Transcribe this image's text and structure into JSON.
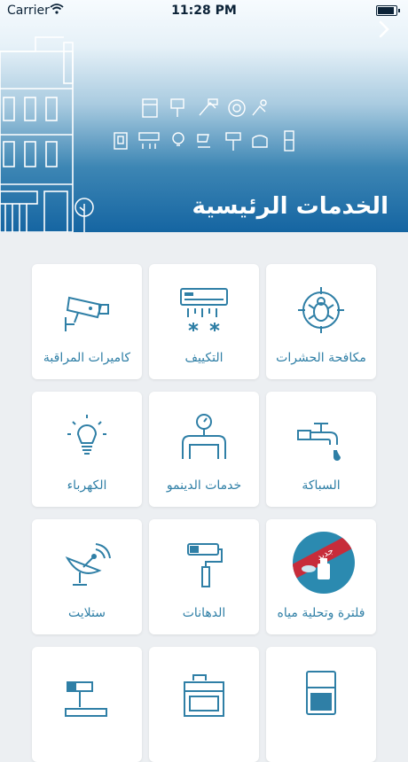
{
  "status_bar": {
    "carrier": "Carrier",
    "time": "11:28 PM"
  },
  "header": {
    "title": "الخدمات الرئيسية"
  },
  "services": [
    {
      "label": "مكافحة الحشرات",
      "icon": "bug-target-icon"
    },
    {
      "label": "التكييف",
      "icon": "air-conditioner-icon"
    },
    {
      "label": "كاميرات المراقبة",
      "icon": "security-camera-icon"
    },
    {
      "label": "السباكة",
      "icon": "water-tap-icon"
    },
    {
      "label": "خدمات الدينمو",
      "icon": "pipe-gauge-icon"
    },
    {
      "label": "الكهرباء",
      "icon": "light-bulb-icon"
    },
    {
      "label": "فلترة وتحلية مياه",
      "icon": "water-filter-icon",
      "badge": "جديد"
    },
    {
      "label": "الدهانات",
      "icon": "paint-roller-icon"
    },
    {
      "label": "ستلايت",
      "icon": "satellite-dish-icon"
    },
    {
      "label": "",
      "icon": "refrigerator-icon"
    },
    {
      "label": "",
      "icon": "stove-icon"
    },
    {
      "label": "",
      "icon": "hammer-icon"
    }
  ],
  "colors": {
    "accent": "#2f7fa6",
    "header_dark": "#1565a2"
  }
}
